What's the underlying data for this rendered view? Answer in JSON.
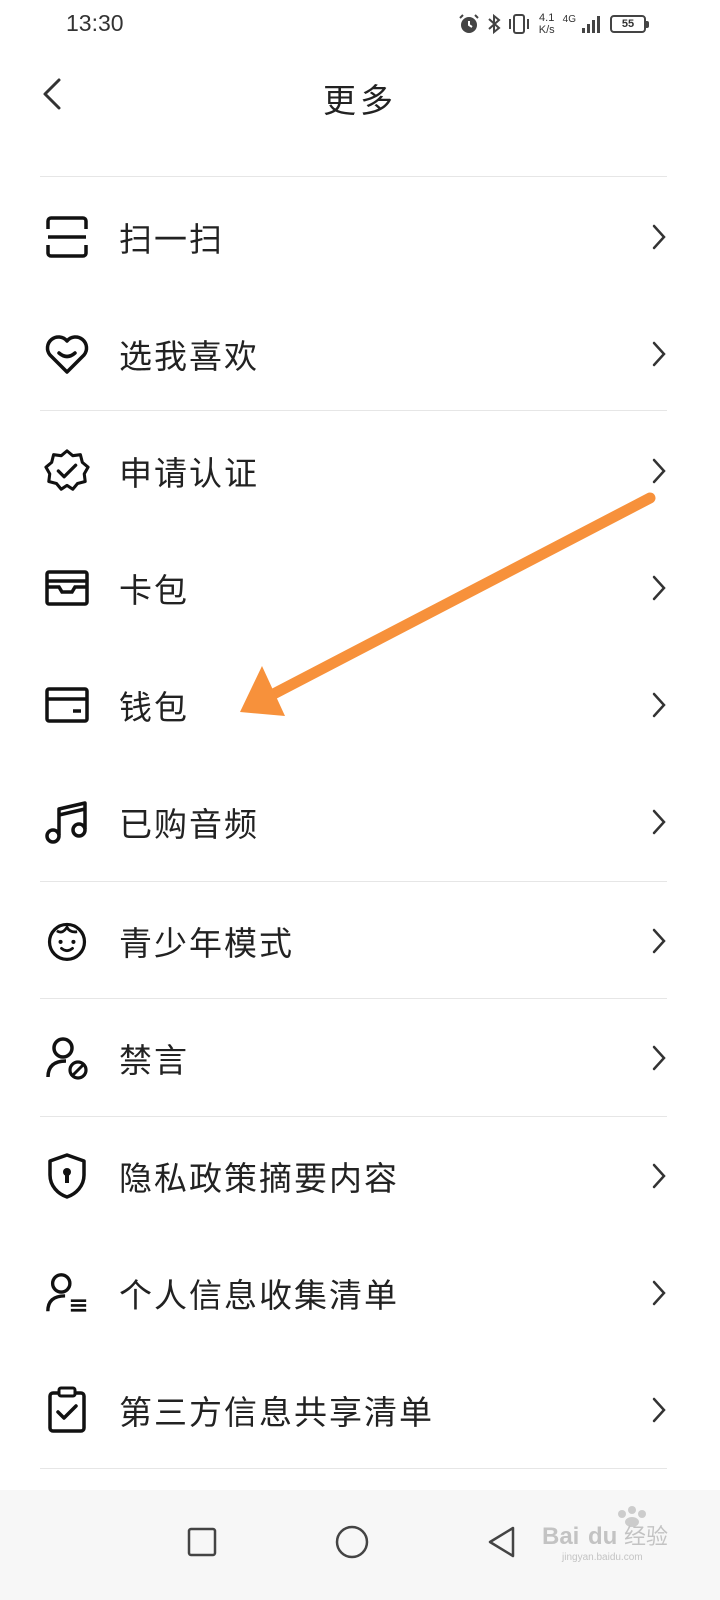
{
  "status_bar": {
    "time": "13:30",
    "net_speed_value": "4.1",
    "net_speed_unit": "K/s",
    "network_generation": "4G",
    "battery": "55"
  },
  "header": {
    "title": "更多",
    "back_icon": "chevron-left-icon"
  },
  "menu": [
    {
      "label": "扫一扫",
      "icon": "scan-icon"
    },
    {
      "label": "选我喜欢",
      "icon": "heart-icon"
    },
    {
      "label": "申请认证",
      "icon": "verified-badge-icon"
    },
    {
      "label": "卡包",
      "icon": "card-holder-icon"
    },
    {
      "label": "钱包",
      "icon": "wallet-icon"
    },
    {
      "label": "已购音频",
      "icon": "music-note-icon"
    },
    {
      "label": "青少年模式",
      "icon": "child-face-icon"
    },
    {
      "label": "禁言",
      "icon": "user-mute-icon"
    },
    {
      "label": "隐私政策摘要内容",
      "icon": "shield-lock-icon"
    },
    {
      "label": "个人信息收集清单",
      "icon": "user-list-icon"
    },
    {
      "label": "第三方信息共享清单",
      "icon": "clipboard-check-icon"
    }
  ],
  "annotation": {
    "color": "#f7913b"
  },
  "watermark": {
    "text": "Baidu经验",
    "url": "jingyan.baidu.com"
  },
  "nav": {
    "icons": [
      "recents-square-icon",
      "home-circle-icon",
      "back-triangle-icon"
    ]
  }
}
